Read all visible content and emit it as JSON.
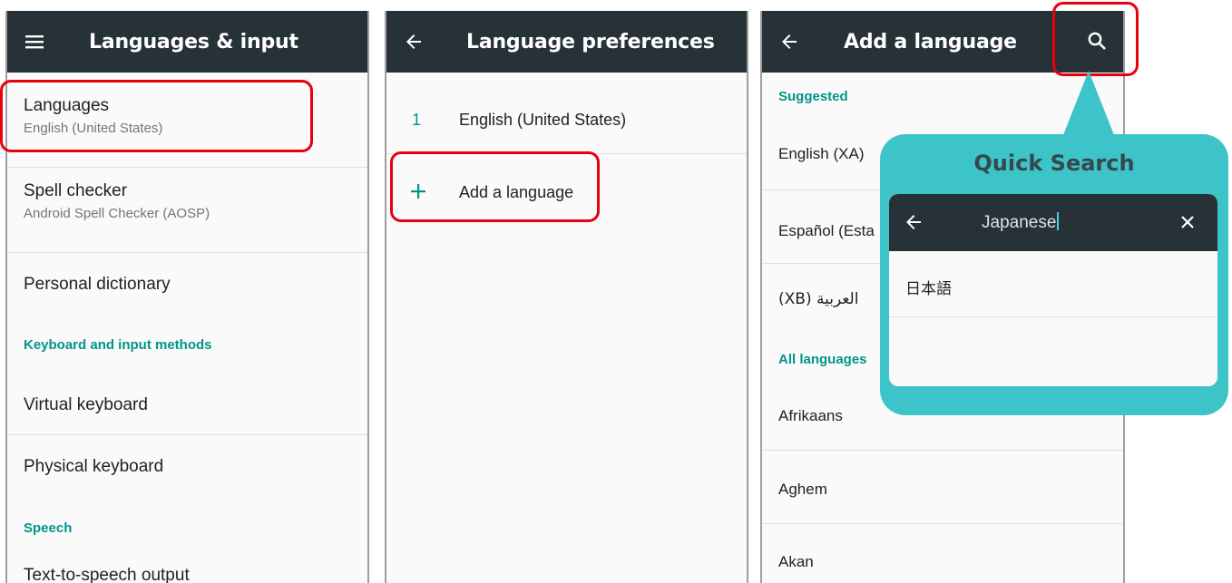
{
  "screen1": {
    "title": "Languages & input",
    "nav_icon": "menu-icon",
    "items": [
      {
        "primary": "Languages",
        "secondary": "English (United States)"
      },
      {
        "primary": "Spell checker",
        "secondary": "Android Spell Checker (AOSP)"
      },
      {
        "primary": "Personal dictionary"
      }
    ],
    "section_keyboard": "Keyboard and input methods",
    "keyboard_items": [
      "Virtual keyboard",
      "Physical keyboard"
    ],
    "section_speech": "Speech",
    "speech_items": [
      "Text-to-speech output"
    ]
  },
  "screen2": {
    "title": "Language preferences",
    "nav_icon": "back-arrow-icon",
    "languages": [
      {
        "number": "1",
        "name": "English (United States)"
      }
    ],
    "add_label": "Add a language",
    "add_icon": "plus-icon"
  },
  "screen3": {
    "title": "Add a language",
    "nav_icon": "back-arrow-icon",
    "action_icon": "search-icon",
    "section_suggested": "Suggested",
    "suggested": [
      "English (XA)",
      "Español (Esta",
      "(XB) العربية"
    ],
    "section_all": "All languages",
    "all": [
      "Afrikaans",
      "Aghem",
      "Akan"
    ]
  },
  "quick_search": {
    "title": "Quick Search",
    "query": "Japanese",
    "result": "日本語",
    "back_icon": "back-arrow-icon",
    "close_icon": "close-icon"
  },
  "colors": {
    "appbar": "#263238",
    "accent": "#009688",
    "highlight": "#e8000b",
    "callout": "#3cc4c8"
  }
}
